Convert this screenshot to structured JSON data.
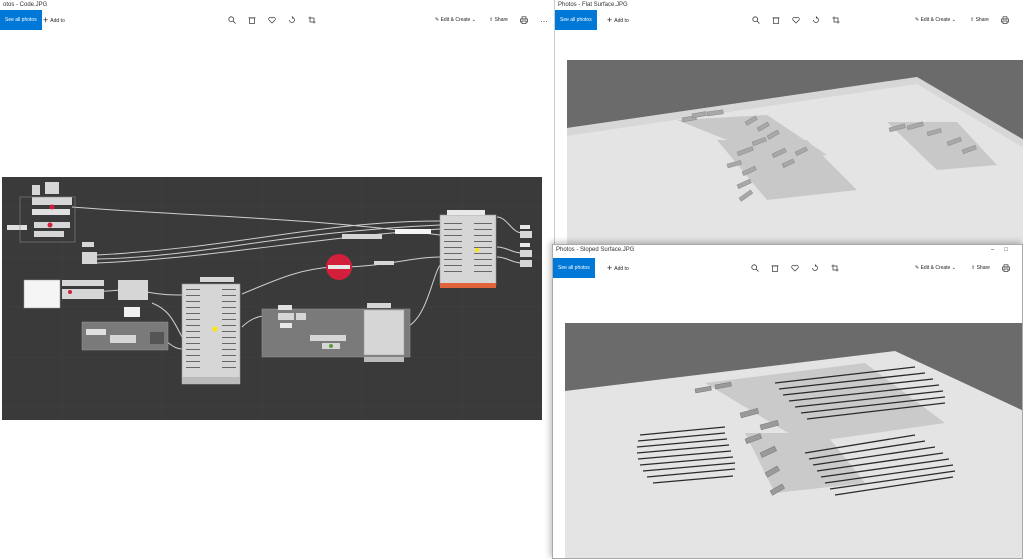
{
  "windows": {
    "code": {
      "title": "otos - Code.JPG",
      "see_all": "See all photos",
      "add_to": "Add to",
      "edit_create": "Edit & Create",
      "share": "Share"
    },
    "flat": {
      "title": "Photos - Flat Surface.JPG",
      "see_all": "See all photos",
      "add_to": "Add to",
      "edit_create": "Edit & Create",
      "share": "Share"
    },
    "sloped": {
      "title": "Photos - Sloped Surface.JPG",
      "see_all": "See all photos",
      "add_to": "Add to",
      "edit_create": "Edit & Create",
      "share": "Share"
    }
  },
  "colors": {
    "accent": "#0078d7",
    "gh_canvas": "#3a3a3a",
    "render_bg": "#6b6b6b",
    "plane": "#e4e4e4",
    "highlight_red": "#d21f3c"
  },
  "icons": [
    "zoom-icon",
    "delete-icon",
    "heart-icon",
    "rotate-icon",
    "crop-icon",
    "edit-icon",
    "share-icon",
    "print-icon",
    "more-icon"
  ]
}
